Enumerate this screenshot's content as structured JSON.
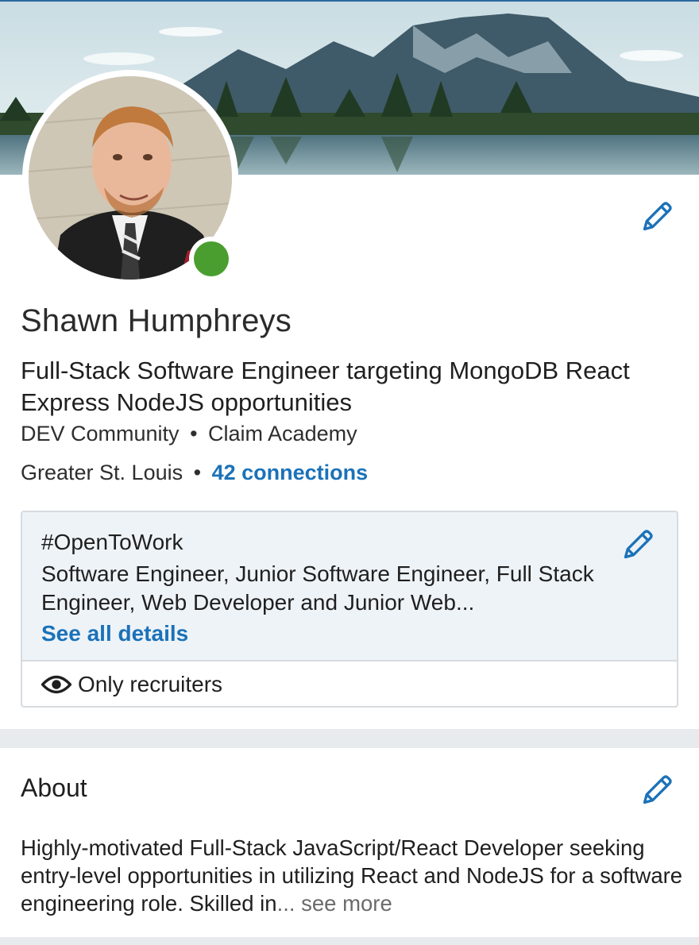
{
  "profile": {
    "name": "Shawn Humphreys",
    "headline": "Full-Stack Software Engineer targeting MongoDB React Express NodeJS opportunities",
    "company": "DEV Community",
    "school": "Claim Academy",
    "separator": "•",
    "location": "Greater St. Louis",
    "connections": "42 connections",
    "online_status_color": "#4a9e2f"
  },
  "open_to_work": {
    "title": "#OpenToWork",
    "description": "Software Engineer, Junior Software Engineer, Full Stack Engineer, Web Developer and Junior Web...",
    "see_all_label": "See all details",
    "visibility_label": "Only recruiters"
  },
  "about": {
    "title": "About",
    "text": "Highly-motivated Full-Stack JavaScript/React Developer seeking entry-level opportunities in utilizing React and NodeJS for a software engineering role. Skilled in",
    "ellipsis": "...",
    "see_more_label": "see more"
  },
  "icons": {
    "edit": "pencil-icon",
    "visibility": "eye-icon"
  },
  "colors": {
    "link": "#1b72b8",
    "card_bg": "#eef3f8",
    "divider": "#e8ebee"
  }
}
